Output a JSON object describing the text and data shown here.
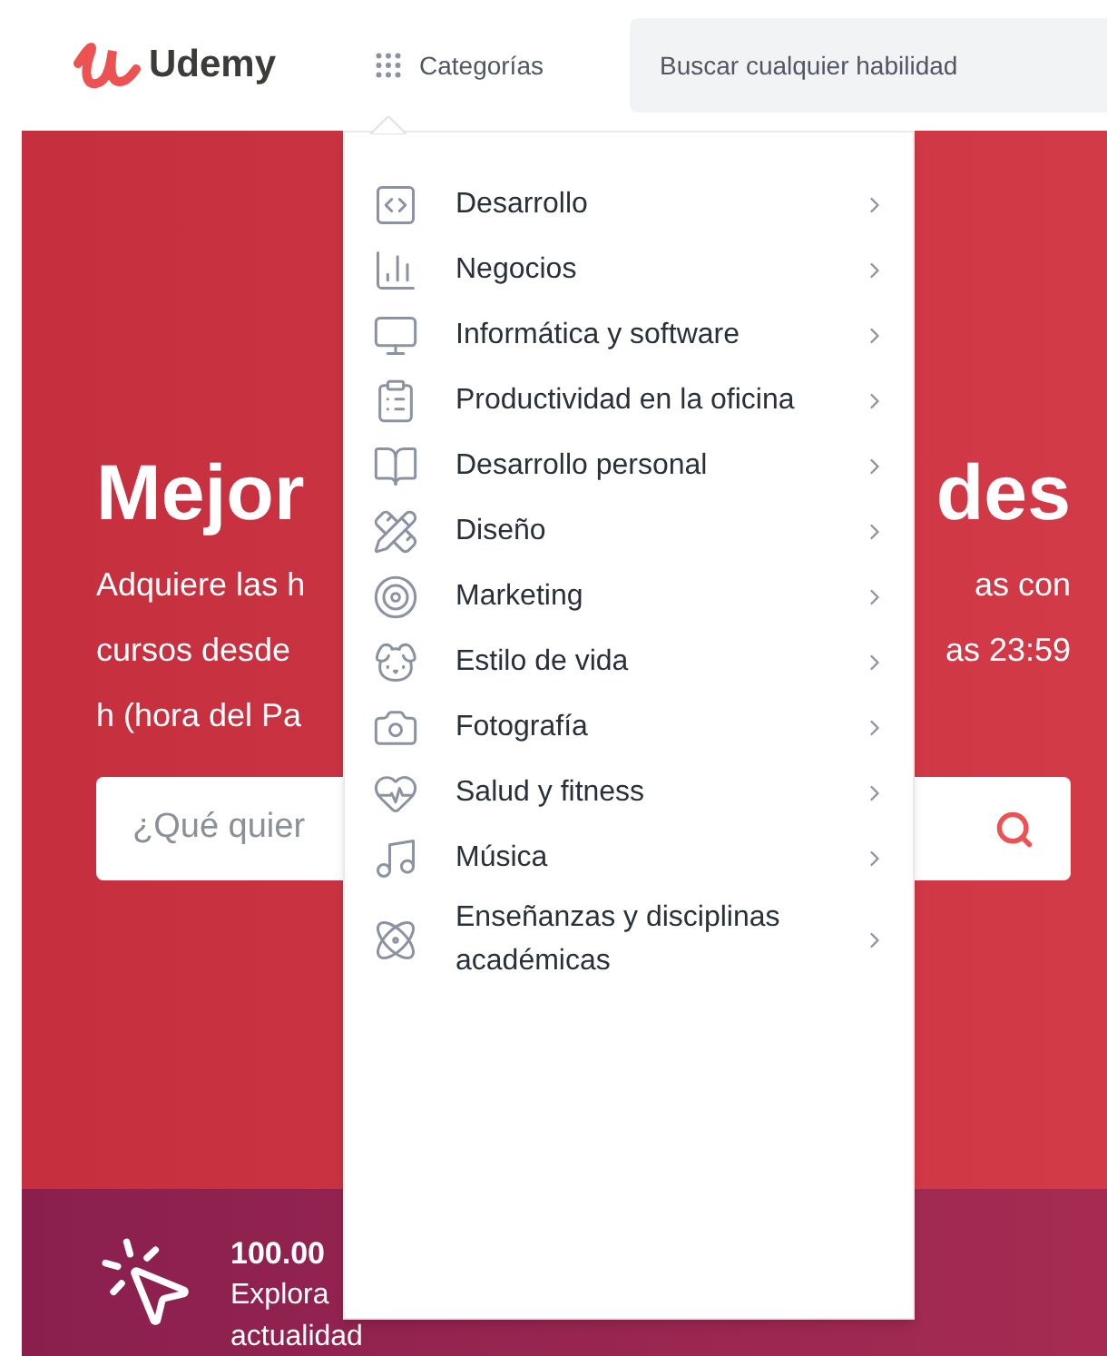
{
  "header": {
    "logo": "Udemy",
    "categories_label": "Categorías",
    "search": {
      "placeholder": "Buscar cualquier habilidad"
    }
  },
  "hero": {
    "title_left": "Mejor",
    "title_right": "des",
    "lines": [
      {
        "left": "Adquiere las h",
        "right": "as con"
      },
      {
        "left": "cursos desde",
        "right": "as 23:59"
      },
      {
        "left": "h (hora del Pa"
      }
    ],
    "search": {
      "placeholder": "¿Qué quier"
    }
  },
  "menu": {
    "items": [
      {
        "label": "Desarrollo"
      },
      {
        "label": "Negocios"
      },
      {
        "label": "Informática y software"
      },
      {
        "label": "Productividad en la oficina"
      },
      {
        "label": "Desarrollo personal"
      },
      {
        "label": "Diseño"
      },
      {
        "label": "Marketing"
      },
      {
        "label": "Estilo de vida"
      },
      {
        "label": "Fotografía"
      },
      {
        "label": "Salud y fitness"
      },
      {
        "label": "Música"
      },
      {
        "label": "Enseñanzas y disciplinas académicas"
      }
    ]
  },
  "banner": {
    "title": "100.00",
    "lines": [
      "Explora",
      "actualidad"
    ]
  }
}
